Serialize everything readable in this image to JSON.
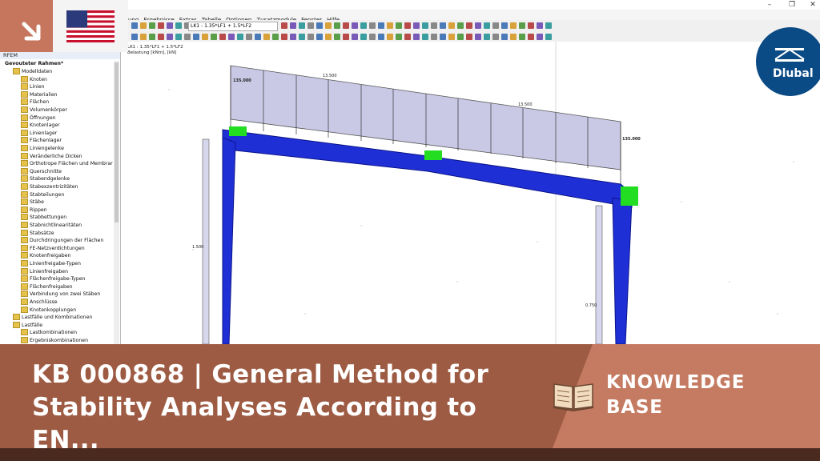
{
  "menu": [
    "ung",
    "Ergebnisse",
    "Extras",
    "Tabelle",
    "Optionen",
    "Zusatzmodule",
    "Fenster",
    "Hilfe"
  ],
  "toolbar": {
    "load_case": "LK1 - 1.35*LF1 + 1.5*LF2"
  },
  "view": {
    "info_line1": "LK1 : 1.35*LF1 + 1.5*LF2",
    "info_line2": "Belastung [kNm], [kN]",
    "loads": {
      "left": "135.000",
      "mid1": "13.500",
      "mid2": "13.500",
      "right": "135.000",
      "col_left": "1.500",
      "col_right": "0.750"
    }
  },
  "navigator": {
    "root": "RFEM",
    "model": "Gevouteter Rahmen*",
    "items": [
      "Modelldaten",
      "Knoten",
      "Linien",
      "Materialien",
      "Flächen",
      "Volumenkörper",
      "Öffnungen",
      "Knotenlager",
      "Linienlager",
      "Flächenlager",
      "Liniengelenke",
      "Veränderliche Dicken",
      "Orthotrope Flächen und Membrar",
      "Querschnitte",
      "Stabendgelenke",
      "Stabexzentrizitäten",
      "Stabteilungen",
      "Stäbe",
      "Rippen",
      "Stabbettungen",
      "Stabnichtlinearitäten",
      "Stabsätze",
      "Durchdringungen der Flächen",
      "FE-Netzverdichtungen",
      "Knotenfreigaben",
      "Linienfreigabe-Typen",
      "Linienfreigaben",
      "Flächenfreigabe-Typen",
      "Flächenfreigaben",
      "Verbindung von zwei Stäben",
      "Anschlüsse",
      "Knotenkopplungen",
      "Lastfälle und Kombinationen",
      "Lastfälle",
      "Lastkombinationen",
      "Ergebniskombinationen"
    ]
  },
  "brand": {
    "name": "Dlubal",
    "color": "#0a4a85"
  },
  "banner": {
    "title": "KB 000868 | General Method for Stability Analyses According to EN...",
    "label": "KNOWLEDGE BASE",
    "label_line1": "KNOWLEDGE",
    "label_line2": "BASE"
  },
  "colors": {
    "banner_dark": "#9e5b43",
    "banner_light": "#c57b62",
    "frame_blue": "#1f2fd6",
    "support_green": "#22dd22"
  }
}
